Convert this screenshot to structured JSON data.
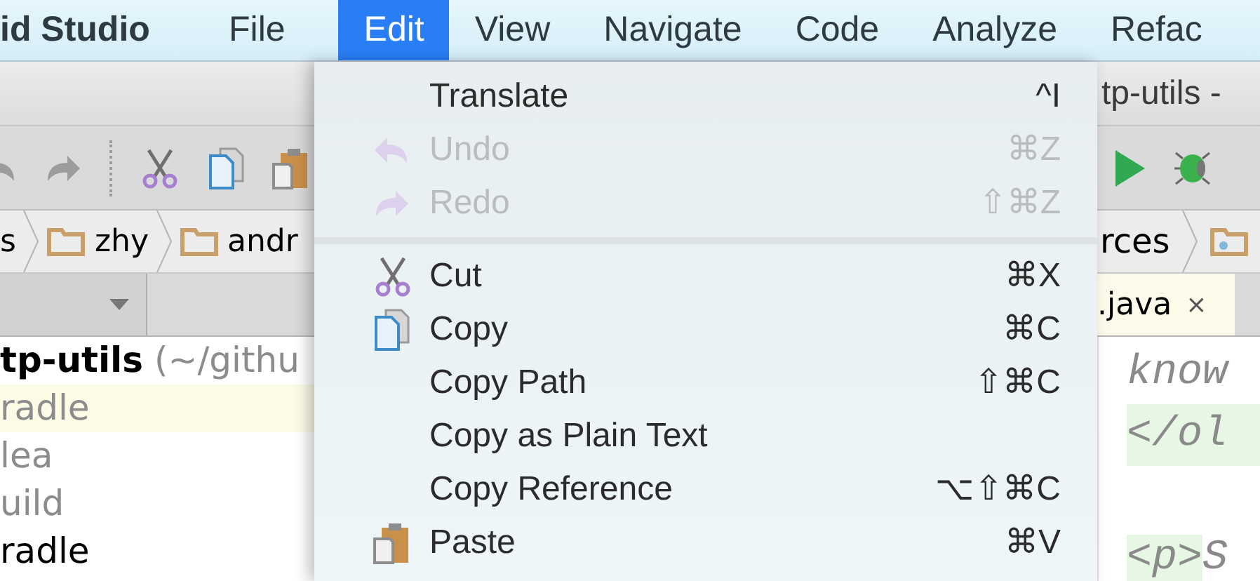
{
  "menu_bar": {
    "app_title": "id Studio",
    "menus": [
      {
        "label": "File",
        "selected": false
      },
      {
        "label": "Edit",
        "selected": true
      },
      {
        "label": "View",
        "selected": false
      },
      {
        "label": "Navigate",
        "selected": false
      },
      {
        "label": "Code",
        "selected": false
      },
      {
        "label": "Analyze",
        "selected": false
      },
      {
        "label": "Refac",
        "selected": false
      }
    ]
  },
  "window_title": "tp-utils -",
  "breadcrumbs": [
    {
      "label": "s",
      "kind": "text"
    },
    {
      "label": "zhy",
      "kind": "folder"
    },
    {
      "label": "andr",
      "kind": "folder"
    }
  ],
  "breadcrumbs_right": [
    {
      "label": "rces"
    }
  ],
  "editor_tab": {
    "label": ".java",
    "close": "×"
  },
  "project_tree": [
    {
      "name": "tp-utils",
      "path": "(~/githu",
      "dimmed": false,
      "highlighted": false,
      "children": [
        {
          "name": "radle",
          "dimmed": true,
          "highlighted": true
        },
        {
          "name": "lea",
          "dimmed": true,
          "highlighted": false
        },
        {
          "name": "uild",
          "dimmed": true,
          "highlighted": false
        },
        {
          "name": "radle",
          "dimmed": false,
          "highlighted": false
        }
      ]
    }
  ],
  "code_lines": [
    {
      "kind": "comment",
      "text": "know"
    },
    {
      "kind": "tag",
      "text": "</ol"
    },
    {
      "kind": "blank"
    },
    {
      "kind": "mixed",
      "tag": "<p>",
      "text": "S"
    }
  ],
  "edit_menu": {
    "items": [
      {
        "kind": "plain",
        "label": "Translate",
        "shortcut": "^I",
        "disabled": false
      },
      {
        "kind": "undo",
        "label": "Undo",
        "shortcut": "⌘Z",
        "disabled": true
      },
      {
        "kind": "redo",
        "label": "Redo",
        "shortcut": "⇧⌘Z",
        "disabled": true
      },
      {
        "kind": "separator"
      },
      {
        "kind": "cut",
        "label": "Cut",
        "shortcut": "⌘X",
        "disabled": false
      },
      {
        "kind": "copy",
        "label": "Copy",
        "shortcut": "⌘C",
        "disabled": false
      },
      {
        "kind": "plain",
        "label": "Copy Path",
        "shortcut": "⇧⌘C",
        "disabled": false
      },
      {
        "kind": "plain",
        "label": "Copy as Plain Text",
        "disabled": false
      },
      {
        "kind": "plain",
        "label": "Copy Reference",
        "shortcut": "⌥⇧⌘C",
        "disabled": false
      },
      {
        "kind": "paste",
        "label": "Paste",
        "shortcut": "⌘V",
        "disabled": false
      }
    ]
  }
}
